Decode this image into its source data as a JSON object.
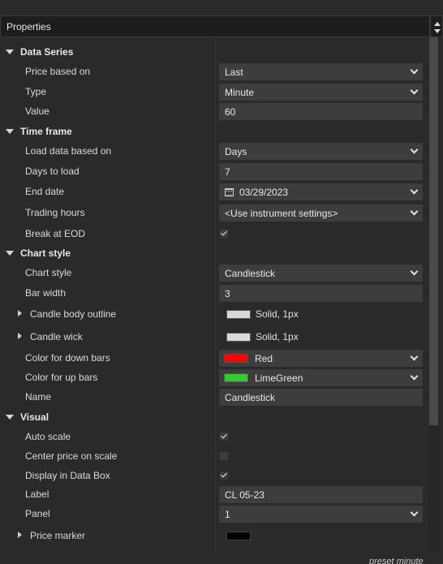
{
  "panel": {
    "title": "Properties"
  },
  "sections": {
    "data_series": {
      "title": "Data Series",
      "price_based_on": {
        "label": "Price based on",
        "value": "Last"
      },
      "type": {
        "label": "Type",
        "value": "Minute"
      },
      "value": {
        "label": "Value",
        "value": "60"
      }
    },
    "time_frame": {
      "title": "Time frame",
      "load_data_based_on": {
        "label": "Load data based on",
        "value": "Days"
      },
      "days_to_load": {
        "label": "Days to load",
        "value": "7"
      },
      "end_date": {
        "label": "End date",
        "value": "03/29/2023"
      },
      "trading_hours": {
        "label": "Trading hours",
        "value": "<Use instrument settings>"
      },
      "break_at_eod": {
        "label": "Break at EOD",
        "checked": true
      }
    },
    "chart_style": {
      "title": "Chart style",
      "chart_style": {
        "label": "Chart style",
        "value": "Candlestick"
      },
      "bar_width": {
        "label": "Bar width",
        "value": "3"
      },
      "candle_body_outline": {
        "label": "Candle body outline",
        "value": "Solid, 1px",
        "color": "#d9d9d9"
      },
      "candle_wick": {
        "label": "Candle wick",
        "value": "Solid, 1px",
        "color": "#d9d9d9"
      },
      "color_down": {
        "label": "Color for down bars",
        "value": "Red",
        "color": "#ff0000"
      },
      "color_up": {
        "label": "Color for up bars",
        "value": "LimeGreen",
        "color": "#32cd32"
      },
      "name": {
        "label": "Name",
        "value": "Candlestick"
      }
    },
    "visual": {
      "title": "Visual",
      "auto_scale": {
        "label": "Auto scale",
        "checked": true
      },
      "center_price": {
        "label": "Center price on scale",
        "checked": false
      },
      "display_in_data_box": {
        "label": "Display in Data Box",
        "checked": true
      },
      "label": {
        "label": "Label",
        "value": "CL 05-23"
      },
      "panel": {
        "label": "Panel",
        "value": "1"
      },
      "price_marker": {
        "label": "Price marker",
        "color": "#000000"
      }
    }
  },
  "footer": {
    "text": "preset minute"
  }
}
